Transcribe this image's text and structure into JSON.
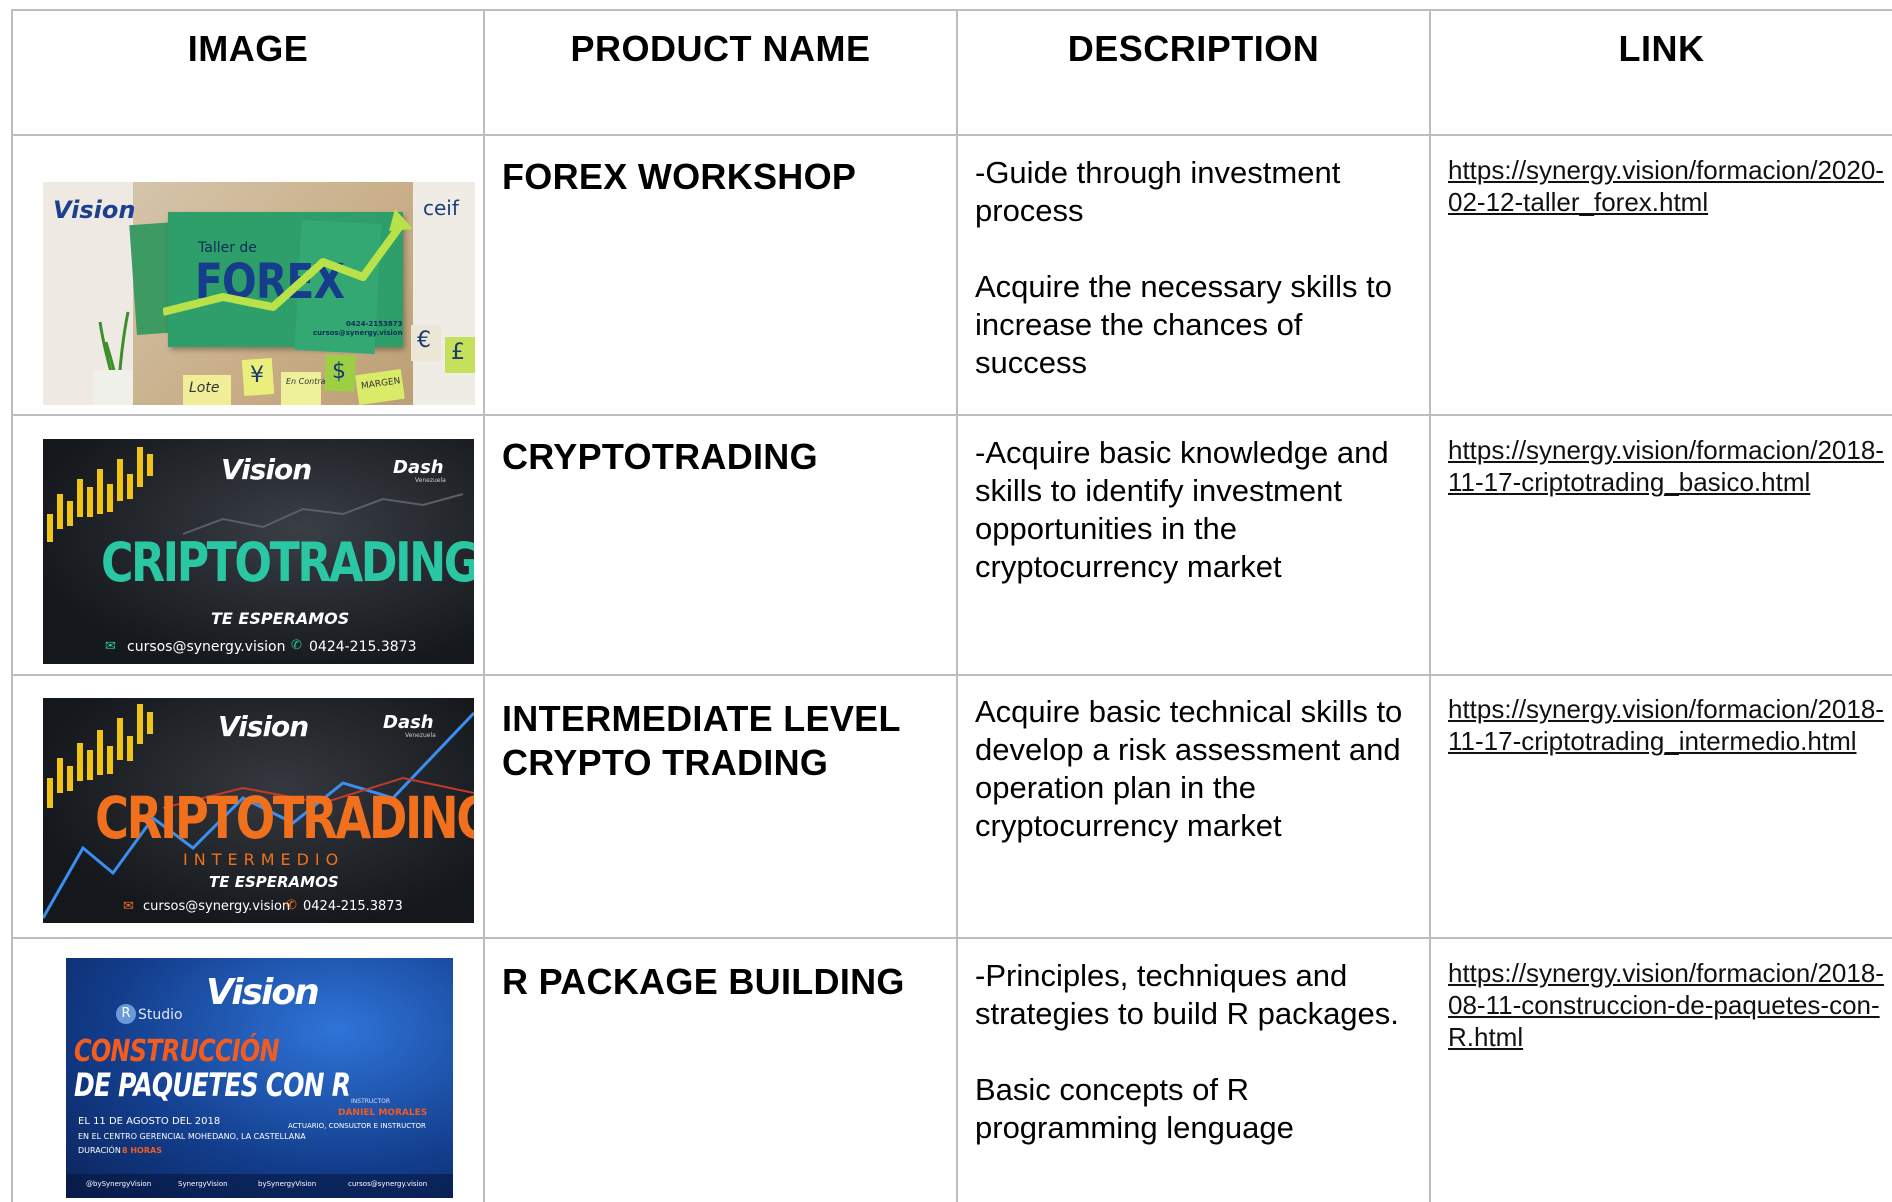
{
  "headers": {
    "image": "IMAGE",
    "product_name": "PRODUCT NAME",
    "description": "DESCRIPTION",
    "link": "LINK"
  },
  "rows": [
    {
      "name": "FOREX WORKSHOP",
      "description": [
        "-Guide through investment process",
        "Acquire the necessary skills to increase the chances of success"
      ],
      "link": "https://synergy.vision/formacion/2020-02-12-taller_forex.html",
      "image": {
        "brand": "Vision",
        "partner": "ceif",
        "title_small": "Taller de",
        "title_big": "FOREX",
        "phone": "0424-2153873",
        "email": "cursos@synergy.vision",
        "notes": [
          "¥",
          "$",
          "€",
          "£"
        ],
        "tags": [
          "Lote",
          "En Contra",
          "MARGEN"
        ]
      }
    },
    {
      "name": "CRYPTOTRADING",
      "description": [
        "-Acquire basic knowledge and skills to identify investment opportunities in the cryptocurrency market"
      ],
      "link": "https://synergy.vision/formacion/2018-11-17-criptotrading_basico.html",
      "image": {
        "brand": "Vision",
        "partner": "Dash",
        "partner_sub": "Venezuela",
        "title_big": "CRIPTOTRADING",
        "tagline": "TE ESPERAMOS",
        "email": "cursos@synergy.vision",
        "phone": "0424-215.3873"
      }
    },
    {
      "name": "INTERMEDIATE LEVEL CRYPTO TRADING",
      "description": [
        "Acquire basic technical skills to develop a risk assessment and operation plan in the cryptocurrency market"
      ],
      "link": "https://synergy.vision/formacion/2018-11-17-criptotrading_intermedio.html",
      "image": {
        "brand": "Vision",
        "partner": "Dash",
        "partner_sub": "Venezuela",
        "title_big": "CRIPTOTRADING",
        "subtitle": "INTERMEDIO",
        "tagline": "TE ESPERAMOS",
        "email": "cursos@synergy.vision",
        "phone": "0424-215.3873"
      }
    },
    {
      "name": "R PACKAGE BUILDING",
      "description": [
        "-Principles, techniques and strategies to build R packages.",
        "Basic concepts of R programming lenguage"
      ],
      "link": "https://synergy.vision/formacion/2018-08-11-construccion-de-paquetes-con-R.html",
      "image": {
        "brand": "Vision",
        "rstudio": "Studio",
        "title_line1": "CONSTRUCCIÓN",
        "title_line2": "DE PAQUETES CON R",
        "date": "EL 11 DE AGOSTO DEL 2018",
        "place": "EN EL CENTRO GERENCIAL MOHEDANO, LA CASTELLANA",
        "duration_label": "DURACIÓN",
        "duration_value": "8 HORAS",
        "instructor_label": "INSTRUCTOR",
        "instructor_name": "DANIEL MORALES",
        "instructor_role": "ACTUARIO, CONSULTOR E INSTRUCTOR",
        "socials": [
          "@bySynergyVision",
          "SynergyVision",
          "bySynergyVision",
          "cursos@synergy.vision"
        ]
      }
    }
  ],
  "colors": {
    "grid": "#bdbdbd",
    "forex_green": "#2e9e6a",
    "crypto_teal": "#29c7a3",
    "crypto_orange": "#f0701e",
    "r_blue": "#1a4fb0",
    "r_orange": "#f25c1f"
  }
}
